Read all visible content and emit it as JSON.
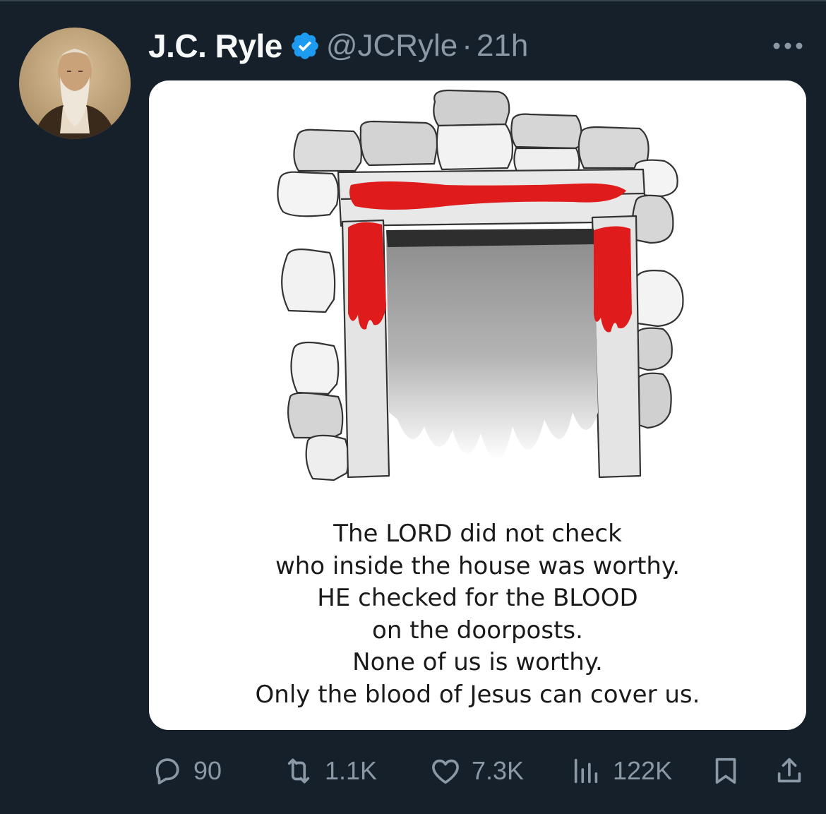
{
  "tweet": {
    "author": {
      "display_name": "J.C. Ryle",
      "handle": "@JCRyle",
      "verified": true
    },
    "separator": "·",
    "timestamp": "21h",
    "media": {
      "caption_lines": [
        "The LORD did not check",
        "who inside the house was worthy.",
        "HE checked for the BLOOD",
        "on the doorposts.",
        "None of us is worthy.",
        "Only the blood of Jesus can cover us."
      ]
    },
    "actions": {
      "replies": "90",
      "retweets": "1.1K",
      "likes": "7.3K",
      "views": "122K"
    }
  },
  "icons": {
    "verified": "verified-badge-icon",
    "more": "more-dots-icon",
    "reply": "reply-icon",
    "retweet": "retweet-icon",
    "like": "heart-icon",
    "views": "views-chart-icon",
    "bookmark": "bookmark-icon",
    "share": "share-icon"
  },
  "colors": {
    "background": "#15202b",
    "text_primary": "#f7f9f9",
    "text_secondary": "#8b98a5",
    "verified_blue": "#1d9bf0",
    "blood_red": "#e01b1b"
  }
}
